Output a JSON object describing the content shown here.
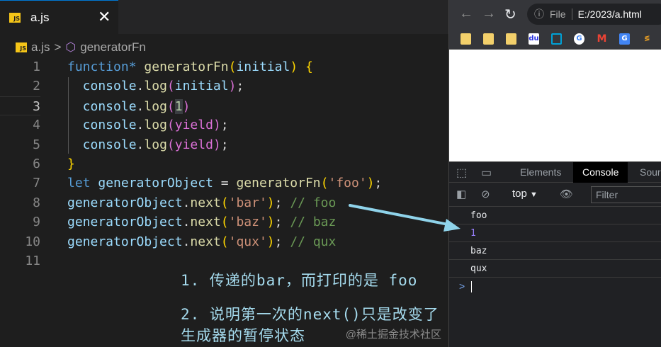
{
  "editor": {
    "tab": {
      "icon": "js-file-icon",
      "label": "a.js"
    },
    "breadcrumb": {
      "file": "a.js",
      "separator": ">",
      "symbol": "generatorFn",
      "symbol_icon": "cube-icon"
    },
    "active_line": 3,
    "lines": [
      {
        "num": "1",
        "tokens": [
          [
            "function*",
            "kw"
          ],
          [
            " ",
            "pl"
          ],
          [
            "generatorFn",
            "fn"
          ],
          [
            "(",
            "br1"
          ],
          [
            "initial",
            "var"
          ],
          [
            ")",
            "br1"
          ],
          [
            " ",
            "pl"
          ],
          [
            "{",
            "br1"
          ]
        ]
      },
      {
        "num": "2",
        "tokens": [
          [
            "  console",
            "var"
          ],
          [
            ".",
            "pl"
          ],
          [
            "log",
            "fn"
          ],
          [
            "(",
            "br2"
          ],
          [
            "initial",
            "var"
          ],
          [
            ")",
            "br2"
          ],
          [
            ";",
            "pl"
          ]
        ]
      },
      {
        "num": "3",
        "tokens": [
          [
            "  console",
            "var"
          ],
          [
            ".",
            "pl"
          ],
          [
            "log",
            "fn"
          ],
          [
            "(",
            "br2"
          ],
          [
            "1",
            "num2"
          ],
          [
            ")",
            "br2"
          ]
        ]
      },
      {
        "num": "4",
        "tokens": [
          [
            "  console",
            "var"
          ],
          [
            ".",
            "pl"
          ],
          [
            "log",
            "fn"
          ],
          [
            "(",
            "br2"
          ],
          [
            "yield",
            "br2"
          ],
          [
            ")",
            "br2"
          ],
          [
            ";",
            "pl"
          ]
        ]
      },
      {
        "num": "5",
        "tokens": [
          [
            "  console",
            "var"
          ],
          [
            ".",
            "pl"
          ],
          [
            "log",
            "fn"
          ],
          [
            "(",
            "br2"
          ],
          [
            "yield",
            "br2"
          ],
          [
            ")",
            "br2"
          ],
          [
            ";",
            "pl"
          ]
        ]
      },
      {
        "num": "6",
        "tokens": [
          [
            "}",
            "br1"
          ]
        ]
      },
      {
        "num": "7",
        "tokens": [
          [
            "let",
            "kw"
          ],
          [
            " ",
            "pl"
          ],
          [
            "generatorObject",
            "var"
          ],
          [
            " = ",
            "pl"
          ],
          [
            "generatorFn",
            "fn"
          ],
          [
            "(",
            "br1"
          ],
          [
            "'foo'",
            "str"
          ],
          [
            ")",
            "br1"
          ],
          [
            ";",
            "pl"
          ]
        ]
      },
      {
        "num": "8",
        "tokens": [
          [
            "generatorObject",
            "var"
          ],
          [
            ".",
            "pl"
          ],
          [
            "next",
            "fn"
          ],
          [
            "(",
            "br1"
          ],
          [
            "'bar'",
            "str"
          ],
          [
            ")",
            "br1"
          ],
          [
            "; ",
            "pl"
          ],
          [
            "// foo",
            "cm"
          ]
        ]
      },
      {
        "num": "9",
        "tokens": [
          [
            "generatorObject",
            "var"
          ],
          [
            ".",
            "pl"
          ],
          [
            "next",
            "fn"
          ],
          [
            "(",
            "br1"
          ],
          [
            "'baz'",
            "str"
          ],
          [
            ")",
            "br1"
          ],
          [
            "; ",
            "pl"
          ],
          [
            "// baz",
            "cm"
          ]
        ]
      },
      {
        "num": "10",
        "tokens": [
          [
            "generatorObject",
            "var"
          ],
          [
            ".",
            "pl"
          ],
          [
            "next",
            "fn"
          ],
          [
            "(",
            "br1"
          ],
          [
            "'qux'",
            "str"
          ],
          [
            ")",
            "br1"
          ],
          [
            "; ",
            "pl"
          ],
          [
            "// qux",
            "cm"
          ]
        ]
      },
      {
        "num": "11",
        "tokens": []
      }
    ]
  },
  "notes": [
    "1. 传递的bar，而打印的是 foo",
    "2. 说明第一次的next()只是改变了生成器的暂停状态"
  ],
  "watermark": "@稀土掘金技术社区",
  "browser": {
    "address": {
      "scheme_label": "File",
      "url": "E:/2023/a.html"
    },
    "bookmarks": [
      "folder-icon",
      "folder-icon",
      "folder-icon",
      "baidu-icon",
      "bilibili-icon",
      "google-icon",
      "gmail-icon",
      "translate-icon",
      "juejin-icon"
    ],
    "devtools": {
      "tabs": [
        "Elements",
        "Console",
        "Sour"
      ],
      "active_tab": "Console",
      "context": "top",
      "filter_placeholder": "Filter",
      "logs": [
        {
          "text": "foo",
          "type": "string"
        },
        {
          "text": "1",
          "type": "number"
        },
        {
          "text": "baz",
          "type": "string"
        },
        {
          "text": "qux",
          "type": "string"
        }
      ],
      "prompt": ">"
    }
  },
  "colors": {
    "annotation": "#a6dcef",
    "arrow": "#8fd3ea",
    "active_tab": "#000000"
  }
}
